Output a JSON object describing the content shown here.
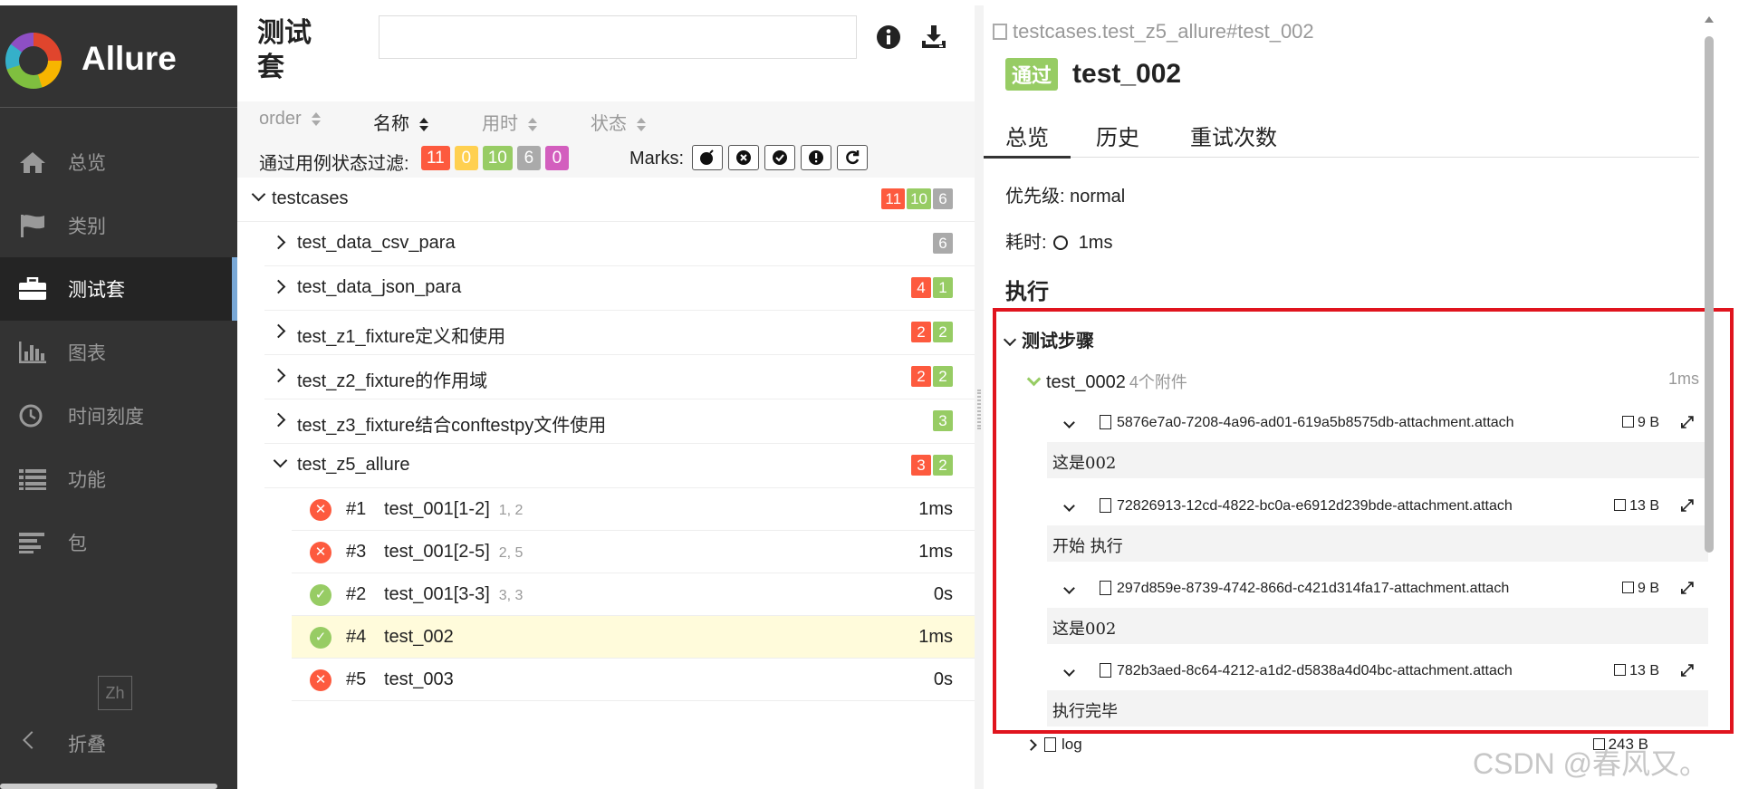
{
  "sidebar": {
    "logo_text": "Allure",
    "items": [
      {
        "label": "总览",
        "icon": "home-icon",
        "active": false
      },
      {
        "label": "类别",
        "icon": "flag-icon",
        "active": false
      },
      {
        "label": "测试套",
        "icon": "briefcase-icon",
        "active": true
      },
      {
        "label": "图表",
        "icon": "bar-chart-icon",
        "active": false
      },
      {
        "label": "时间刻度",
        "icon": "clock-icon",
        "active": false
      },
      {
        "label": "功能",
        "icon": "list-icon",
        "active": false
      },
      {
        "label": "包",
        "icon": "align-left-icon",
        "active": false
      }
    ],
    "lang_button": "Zh",
    "collapse_label": "折叠"
  },
  "suites": {
    "title": "测试套",
    "search_placeholder": "",
    "sort": [
      {
        "label": "order",
        "selected": false
      },
      {
        "label": "名称",
        "selected": true
      },
      {
        "label": "用时",
        "selected": false
      },
      {
        "label": "状态",
        "selected": false
      }
    ],
    "filter_label": "通过用例状态过滤:",
    "filter_badges": [
      "11",
      "0",
      "10",
      "6",
      "0"
    ],
    "marks_label": "Marks:",
    "root": {
      "name": "testcases",
      "counts": [
        "11",
        "10",
        "6"
      ]
    },
    "groups": [
      {
        "name": "test_data_csv_para",
        "counts": [
          "6"
        ],
        "colors": [
          "gry"
        ]
      },
      {
        "name": "test_data_json_para",
        "counts": [
          "4",
          "1"
        ],
        "colors": [
          "red",
          "grn"
        ]
      },
      {
        "name": "test_z1_fixture定义和使用",
        "counts": [
          "2",
          "2"
        ],
        "colors": [
          "red",
          "grn"
        ]
      },
      {
        "name": "test_z2_fixture的作用域",
        "counts": [
          "2",
          "2"
        ],
        "colors": [
          "red",
          "grn"
        ]
      },
      {
        "name": "test_z3_fixture结合conftestpy文件使用",
        "counts": [
          "3"
        ],
        "colors": [
          "grn"
        ]
      },
      {
        "name": "test_z5_allure",
        "counts": [
          "3",
          "2"
        ],
        "colors": [
          "red",
          "grn"
        ]
      }
    ],
    "cases": [
      {
        "num": "#1",
        "name": "test_001[1-2]",
        "params": "1, 2",
        "duration": "1ms",
        "status": "fail"
      },
      {
        "num": "#3",
        "name": "test_001[2-5]",
        "params": "2, 5",
        "duration": "1ms",
        "status": "fail"
      },
      {
        "num": "#2",
        "name": "test_001[3-3]",
        "params": "3, 3",
        "duration": "0s",
        "status": "pass"
      },
      {
        "num": "#4",
        "name": "test_002",
        "params": "",
        "duration": "1ms",
        "status": "pass"
      },
      {
        "num": "#5",
        "name": "test_003",
        "params": "",
        "duration": "0s",
        "status": "fail"
      }
    ]
  },
  "detail": {
    "breadcrumb": "testcases.test_z5_allure#test_002",
    "status_badge": "通过",
    "name": "test_002",
    "tabs": [
      "总览",
      "历史",
      "重试次数"
    ],
    "priority": "优先级: normal",
    "duration_label": "耗时:",
    "duration": "1ms",
    "exec_heading": "执行",
    "steps_heading": "测试步骤",
    "step": {
      "name": "test_0002",
      "attachments": "4个附件",
      "duration": "1ms"
    },
    "attachments": [
      {
        "name": "5876e7a0-7208-4a96-ad01-619a5b8575db-attachment.attach",
        "size": "9 B",
        "content": "这是002"
      },
      {
        "name": "72826913-12cd-4822-bc0a-e6912d239bde-attachment.attach",
        "size": "13 B",
        "content": "开始 执行"
      },
      {
        "name": "297d859e-8739-4742-866d-c421d314fa17-attachment.attach",
        "size": "9 B",
        "content": "这是002"
      },
      {
        "name": "782b3aed-8c64-4212-a1d2-d5838a4d04bc-attachment.attach",
        "size": "13 B",
        "content": "执行完毕"
      }
    ],
    "log": {
      "name": "log",
      "size": "243 B"
    }
  },
  "watermark": "CSDN @春风又。"
}
